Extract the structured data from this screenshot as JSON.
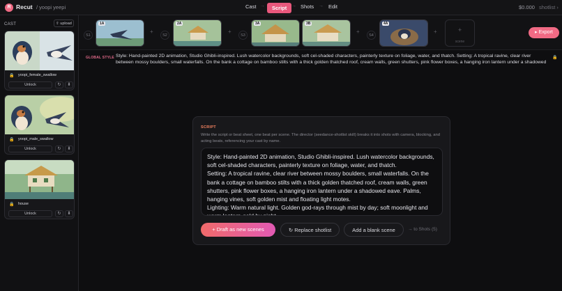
{
  "app": {
    "logo_letter": "R",
    "name": "Recut",
    "project": "/ yoopi yeepi"
  },
  "nav": {
    "steps": [
      "Cast",
      "Script",
      "Shots",
      "Edit"
    ],
    "active": "Script",
    "cost": "$0.000",
    "shotlist": "shotlist ›"
  },
  "cast": {
    "title": "CAST",
    "upload_label": "⇧ upload",
    "items": [
      {
        "name": "yoopi_female_swallow",
        "unlock": "Unlock"
      },
      {
        "name": "yoopi_male_swallow",
        "unlock": "Unlock"
      },
      {
        "name": "house",
        "unlock": "Unlock"
      }
    ]
  },
  "storyboard": {
    "scenes": [
      "S1",
      "S2",
      "S3",
      "S4"
    ],
    "shots": [
      "1A",
      "2A",
      "3A",
      "3B",
      "4A"
    ],
    "new_scene_label": "scene",
    "export_label": "▸ Export"
  },
  "global_style": {
    "label": "GLOBAL STYLE",
    "text": "Style: Hand-painted 2D animation, Studio Ghibli-inspired. Lush watercolor backgrounds, soft cel-shaded characters, painterly texture on foliage, water, and thatch. Setting: A tropical ravine, clear river between mossy boulders, small waterfalls. On the bank a cottage on bamboo stilts with a thick golden thatched roof, cream walls, green shutters, pink flower boxes, a hanging iron lantern under a shadowed eave. Palms, hanging..."
  },
  "script": {
    "title": "SCRIPT",
    "description": "Write the script or beat sheet, one beat per scene. The director (seedance-shotlist skill) breaks it into shots with camera, blocking, and acting beats, referencing your cast by name.",
    "text": "Style: Hand-painted 2D animation, Studio Ghibli-inspired. Lush watercolor backgrounds, soft cel-shaded characters, painterly texture on foliage, water, and thatch.\nSetting: A tropical ravine, clear river between mossy boulders, small waterfalls. On the bank a cottage on bamboo stilts with a thick golden thatched roof, cream walls, green shutters, pink flower boxes, a hanging iron lantern under a shadowed eave. Palms, hanging vines, soft golden mist and floating light motes.\nLighting: Warm natural light. Golden god-rays through mist by day; soft moonlight and warm lantern-gold by night.",
    "draft_label": "+ Draft as new scenes",
    "replace_label": "↻ Replace shotlist",
    "blank_label": "Add a blank scene",
    "to_shots_label": "→ to Shots (5)"
  },
  "colors": {
    "accent": "#e8587c",
    "export": "#f06a84",
    "script_title": "#f28260"
  }
}
